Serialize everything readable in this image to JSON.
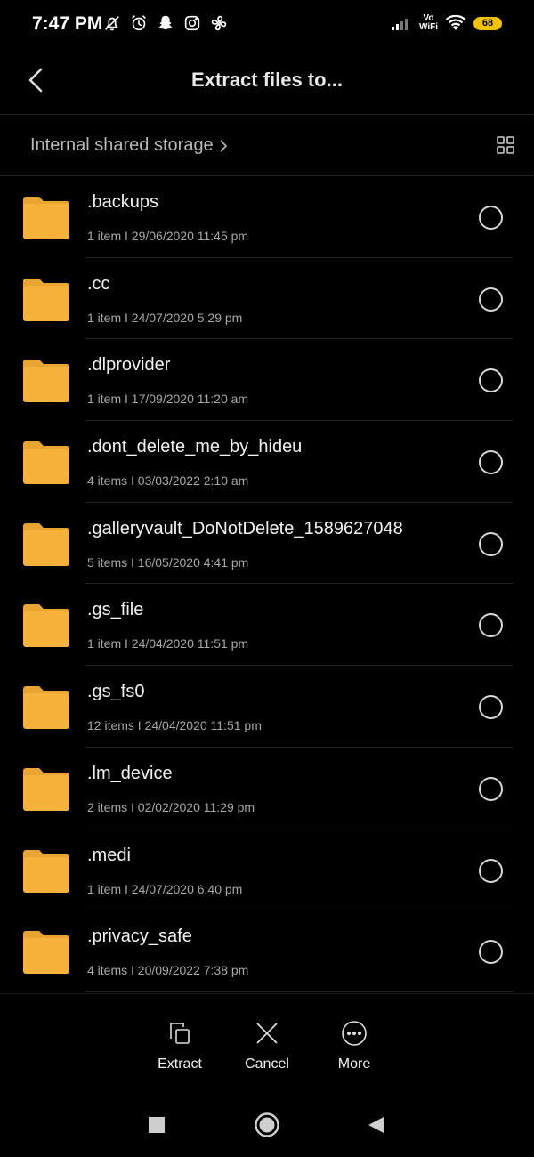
{
  "status_bar": {
    "time": "7:47 PM",
    "icons": [
      "mute-icon",
      "alarm-icon",
      "snapchat-icon",
      "instagram-icon",
      "fan-icon"
    ],
    "volte_line1": "Vo",
    "volte_line2": "WiFi",
    "battery": "68"
  },
  "header": {
    "title": "Extract files to...",
    "back_icon": "back-arrow-icon"
  },
  "path_bar": {
    "breadcrumb": "Internal shared storage",
    "view_icon": "grid-view-icon"
  },
  "colors": {
    "folder": "#f7b23b",
    "folder_tab": "#e9a431",
    "background": "#000000"
  },
  "files": [
    {
      "name": ".backups",
      "meta": "1 item  I  29/06/2020 11:45 pm"
    },
    {
      "name": ".cc",
      "meta": "1 item  I  24/07/2020 5:29 pm"
    },
    {
      "name": ".dlprovider",
      "meta": "1 item  I  17/09/2020 11:20 am"
    },
    {
      "name": ".dont_delete_me_by_hideu",
      "meta": "4 items  I  03/03/2022 2:10 am"
    },
    {
      "name": ".galleryvault_DoNotDelete_1589627048",
      "meta": "5 items  I  16/05/2020 4:41 pm"
    },
    {
      "name": ".gs_file",
      "meta": "1 item  I  24/04/2020 11:51 pm"
    },
    {
      "name": ".gs_fs0",
      "meta": "12 items  I  24/04/2020 11:51 pm"
    },
    {
      "name": ".lm_device",
      "meta": "2 items  I  02/02/2020 11:29 pm"
    },
    {
      "name": ".medi",
      "meta": "1 item  I  24/07/2020 6:40 pm"
    },
    {
      "name": ".privacy_safe",
      "meta": "4 items  I  20/09/2022 7:38 pm"
    }
  ],
  "actions": {
    "extract": "Extract",
    "cancel": "Cancel",
    "more": "More"
  },
  "nav": [
    "recents-square-icon",
    "home-circle-icon",
    "back-triangle-icon"
  ]
}
